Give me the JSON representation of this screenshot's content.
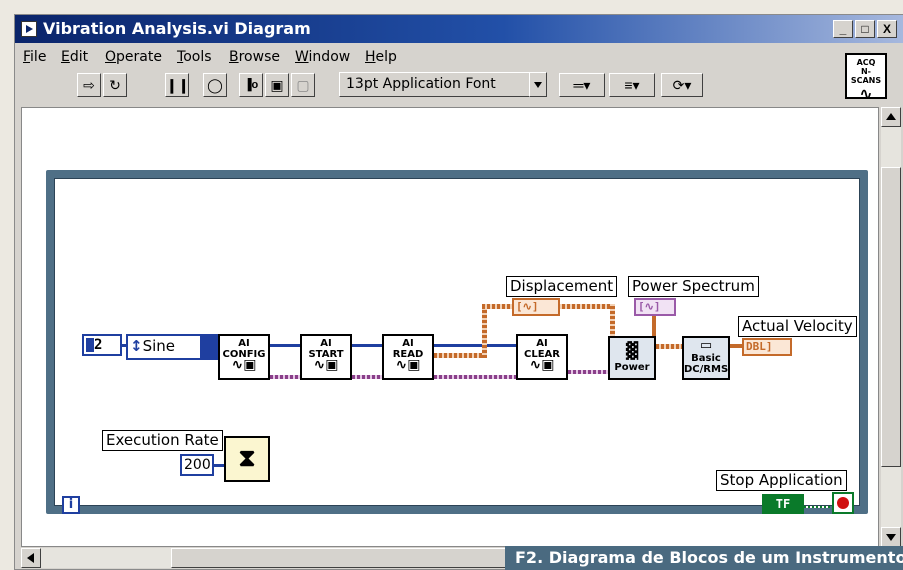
{
  "window": {
    "title": "Vibration Analysis.vi Diagram",
    "controls": [
      "_",
      "□",
      "X"
    ]
  },
  "menu": [
    {
      "key": "F",
      "rest": "ile"
    },
    {
      "key": "E",
      "rest": "dit"
    },
    {
      "key": "O",
      "rest": "perate"
    },
    {
      "key": "T",
      "rest": "ools"
    },
    {
      "key": "B",
      "rest": "rowse"
    },
    {
      "key": "W",
      "rest": "indow"
    },
    {
      "key": "H",
      "rest": "elp"
    }
  ],
  "toolbar": {
    "font_value": "13pt Application Font"
  },
  "vi_icon": {
    "line1": "ACQ",
    "line2": "N-SCANS"
  },
  "diagram": {
    "channel_value": "2",
    "waveform_type": "Sine",
    "nodes": {
      "config": {
        "top": "AI",
        "bottom": "CONFIG"
      },
      "start": {
        "top": "AI",
        "bottom": "START"
      },
      "read": {
        "top": "AI",
        "bottom": "READ"
      },
      "clear": {
        "top": "AI",
        "bottom": "CLEAR"
      },
      "power": "Power",
      "basic": {
        "line1": "Basic",
        "line2": "DC/RMS"
      }
    },
    "labels": {
      "displacement": "Displacement",
      "power_spectrum": "Power Spectrum",
      "actual_velocity": "Actual Velocity",
      "execution_rate": "Execution Rate",
      "stop_application": "Stop Application"
    },
    "terminals": {
      "displacement": "[∿]",
      "power_spectrum": "[∿]",
      "actual_velocity": "DBL]",
      "stop": "TF"
    },
    "execution_rate_value": "200",
    "loop_info": "i"
  },
  "caption": "F2. Diagrama de Blocos de um Instrumento",
  "colors": {
    "titlebar": "#0a246a",
    "loop_border": "#4f6f86",
    "wire_blue": "#1f3fa0",
    "wire_pink": "#8a3f8a",
    "wire_orange": "#c46a2a",
    "caption_bg": "#4a6a80"
  }
}
